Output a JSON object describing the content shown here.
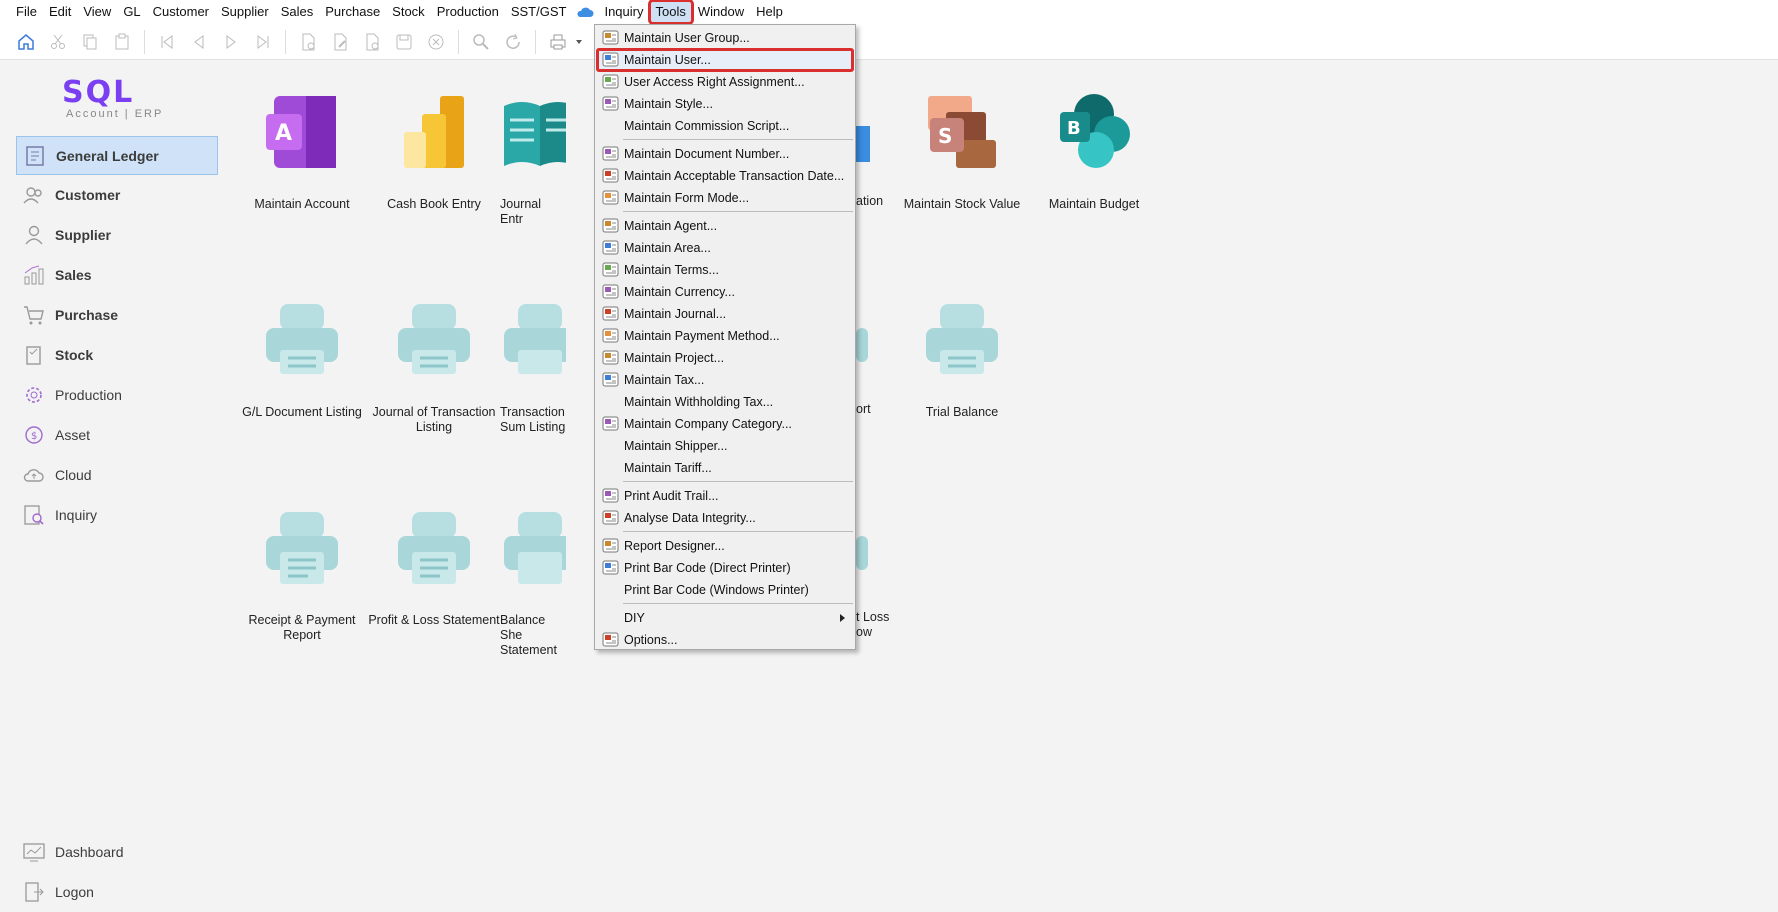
{
  "menubar": {
    "items": [
      "File",
      "Edit",
      "View",
      "GL",
      "Customer",
      "Supplier",
      "Sales",
      "Purchase",
      "Stock",
      "Production",
      "SST/GST",
      "Inquiry",
      "Tools",
      "Window",
      "Help"
    ]
  },
  "logo": {
    "word": "SQL",
    "sub": "Account | ERP"
  },
  "sidebar": {
    "items": [
      {
        "label": "General Ledger",
        "icon": "ledger-icon"
      },
      {
        "label": "Customer",
        "icon": "customer-icon"
      },
      {
        "label": "Supplier",
        "icon": "supplier-icon"
      },
      {
        "label": "Sales",
        "icon": "sales-icon"
      },
      {
        "label": "Purchase",
        "icon": "purchase-cart-icon"
      },
      {
        "label": "Stock",
        "icon": "stock-icon"
      },
      {
        "label": "Production",
        "icon": "production-gear-icon"
      },
      {
        "label": "Asset",
        "icon": "asset-icon"
      },
      {
        "label": "Cloud",
        "icon": "cloud-upload-icon"
      },
      {
        "label": "Inquiry",
        "icon": "inquiry-search-icon"
      }
    ],
    "bottom": [
      {
        "label": "Dashboard",
        "icon": "dashboard-icon"
      },
      {
        "label": "Logon",
        "icon": "logon-icon"
      }
    ]
  },
  "tiles": {
    "row1": [
      "Maintain Account",
      "Cash Book Entry",
      "Journal Entr",
      "ation",
      "Maintain Stock Value",
      "Maintain Budget"
    ],
    "row2": [
      "G/L Document Listing",
      "Journal of Transaction Listing",
      "Transaction Sum Listing",
      "ort",
      "Trial Balance"
    ],
    "row3": [
      "Receipt & Payment Report",
      "Profit & Loss Statement",
      "Balance She Statement",
      "t Loss ow"
    ]
  },
  "tools_menu": {
    "groups": [
      [
        "Maintain User Group...",
        "Maintain User...",
        "User Access Right Assignment...",
        "Maintain Style...",
        "Maintain Commission Script..."
      ],
      [
        "Maintain Document Number...",
        "Maintain Acceptable Transaction Date...",
        "Maintain Form Mode..."
      ],
      [
        "Maintain Agent...",
        "Maintain Area...",
        "Maintain Terms...",
        "Maintain Currency...",
        "Maintain Journal...",
        "Maintain Payment Method...",
        "Maintain Project...",
        "Maintain Tax...",
        "Maintain Withholding Tax...",
        "Maintain Company Category...",
        "Maintain Shipper...",
        "Maintain Tariff..."
      ],
      [
        "Print Audit Trail...",
        "Analyse Data Integrity..."
      ],
      [
        "Report Designer...",
        "Print Bar Code (Direct Printer)",
        "Print Bar Code (Windows Printer)"
      ],
      [
        "DIY",
        "Options..."
      ]
    ],
    "highlighted": "Maintain User..."
  },
  "colors": {
    "accent_red": "#d9302f",
    "brand_purple": "#7a3ff0",
    "selected_nav": "#cfe2f7"
  }
}
